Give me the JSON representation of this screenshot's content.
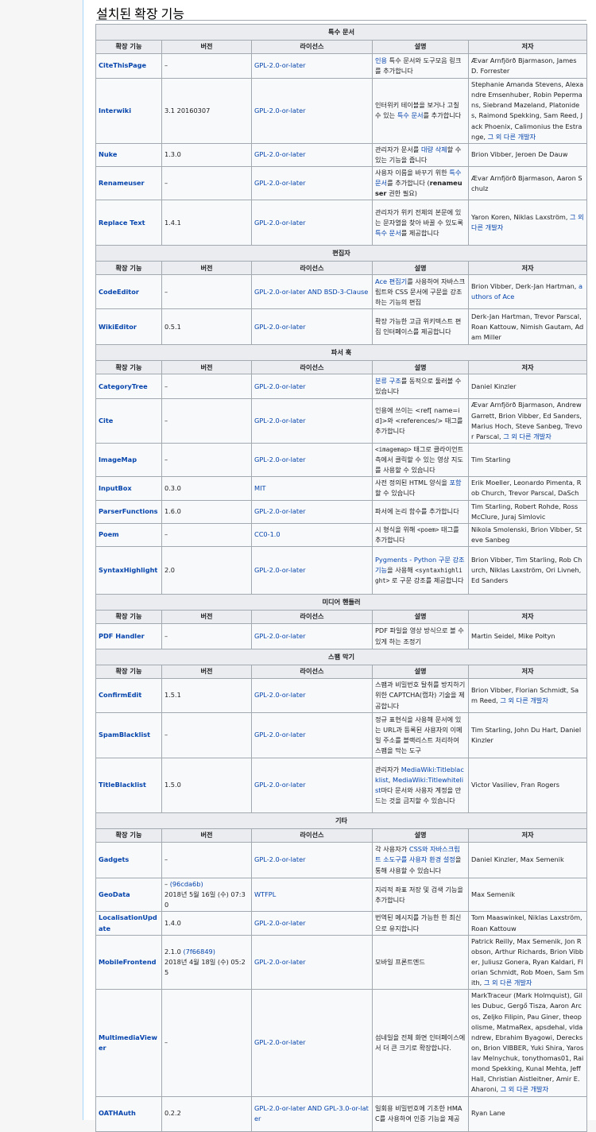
{
  "heading": "설치된 확장 기능",
  "columns": [
    "확장 기능",
    "버전",
    "라이선스",
    "설명",
    "저자"
  ],
  "sections": [
    {
      "title": "특수 문서",
      "rows": [
        {
          "name": "CiteThisPage",
          "version": "–",
          "license": "GPL-2.0-or-later",
          "desc": [
            {
              "t": "인용",
              "l": true
            },
            {
              "t": " 특수 문서와 도구모음 링크를 추가합니다"
            }
          ],
          "authors": [
            {
              "t": "Ævar Arnfjörð Bjarmason, James D. Forrester"
            }
          ]
        },
        {
          "name": "Interwiki",
          "version": "3.1 20160307",
          "license": "GPL-2.0-or-later",
          "desc": [
            {
              "t": "인터위키 테이블을 보거나 고칠 수 있는 "
            },
            {
              "t": "특수 문서",
              "l": true
            },
            {
              "t": "를 추가합니다"
            }
          ],
          "authors": [
            {
              "t": "Stephanie Amanda Stevens, Alexandre Emsenhuber, Robin Pepermans, Siebrand Mazeland, Platonides, Raimond Spekking, Sam Reed, Jack Phoenix, Calimonius the Estrange, "
            },
            {
              "t": "그 외 다른 개발자",
              "l": true
            }
          ]
        },
        {
          "name": "Nuke",
          "version": "1.3.0",
          "license": "GPL-2.0-or-later",
          "desc": [
            {
              "t": "관리자가 문서를 "
            },
            {
              "t": "대량 삭제",
              "l": true
            },
            {
              "t": "할 수 있는 기능을 줍니다"
            }
          ],
          "authors": [
            {
              "t": "Brion Vibber, Jeroen De Dauw"
            }
          ]
        },
        {
          "name": "Renameuser",
          "version": "–",
          "license": "GPL-2.0-or-later",
          "desc": [
            {
              "t": "사용자 이름을 바꾸기 위한 "
            },
            {
              "t": "특수 문서",
              "l": true
            },
            {
              "t": "를 추가합니다 ("
            },
            {
              "t": "renameuser",
              "b": true
            },
            {
              "t": " 권한 필요)"
            }
          ],
          "authors": [
            {
              "t": "Ævar Arnfjörð Bjarmason, Aaron Schulz"
            }
          ]
        },
        {
          "name": "Replace Text",
          "version": "1.4.1",
          "license": "GPL-2.0-or-later",
          "desc": [
            {
              "t": "관리자가 위키 전체의 본문에 있는 문자열을 찾아 바꿀 수 있도록 "
            },
            {
              "t": "특수 문서",
              "l": true
            },
            {
              "t": "를 제공합니다"
            }
          ],
          "authors": [
            {
              "t": "Yaron Koren, Niklas Laxström, "
            },
            {
              "t": "그 외 다른 개발자",
              "l": true
            }
          ]
        }
      ]
    },
    {
      "title": "편집자",
      "rows": [
        {
          "name": "CodeEditor",
          "version": "–",
          "license": "GPL-2.0-or-later AND BSD-3-Clause",
          "desc": [
            {
              "t": "Ace 편집기",
              "l": true
            },
            {
              "t": "를 사용하여 자바스크립트와 CSS 문서에 구문을 강조하는 기능의 편집"
            }
          ],
          "authors": [
            {
              "t": "Brion Vibber, Derk-Jan Hartman, "
            },
            {
              "t": "authors of Ace",
              "l": true
            }
          ]
        },
        {
          "name": "WikiEditor",
          "version": "0.5.1",
          "license": "GPL-2.0-or-later",
          "desc": [
            {
              "t": "확장 가능한 고급 위키텍스트 편집 인터페이스를 제공합니다"
            }
          ],
          "authors": [
            {
              "t": "Derk-Jan Hartman, Trevor Parscal, Roan Kattouw, Nimish Gautam, Adam Miller"
            }
          ]
        }
      ]
    },
    {
      "title": "파서 훅",
      "rows": [
        {
          "name": "CategoryTree",
          "version": "–",
          "license": "GPL-2.0-or-later",
          "desc": [
            {
              "t": "분류 구조",
              "l": true
            },
            {
              "t": "를 동적으로 둘러볼 수 있습니다"
            }
          ],
          "authors": [
            {
              "t": "Daniel Kinzler"
            }
          ]
        },
        {
          "name": "Cite",
          "version": "–",
          "license": "GPL-2.0-or-later",
          "desc": [
            {
              "t": "인용에 쓰이는 <ref[ name=id]>와 <references/> 태그를 추가합니다"
            }
          ],
          "authors": [
            {
              "t": "Ævar Arnfjörð Bjarmason, Andrew Garrett, Brion Vibber, Ed Sanders, Marius Hoch, Steve Sanbeg, Trevor Parscal, "
            },
            {
              "t": "그 외 다른 개발자",
              "l": true
            }
          ]
        },
        {
          "name": "ImageMap",
          "version": "–",
          "license": "GPL-2.0-or-later",
          "desc": [
            {
              "t": "<imagemap>",
              "c": true
            },
            {
              "t": " 태그로 클라이언트 측에서 클릭할 수 있는 영상 지도를 사용할 수 있습니다"
            }
          ],
          "authors": [
            {
              "t": "Tim Starling"
            }
          ]
        },
        {
          "name": "InputBox",
          "version": "0.3.0",
          "license": "MIT",
          "desc": [
            {
              "t": "사전 정의된 HTML 양식을 "
            },
            {
              "t": "포함",
              "l": true
            },
            {
              "t": "할 수 있습니다"
            }
          ],
          "authors": [
            {
              "t": "Erik Moeller, Leonardo Pimenta, Rob Church, Trevor Parscal, DaSch"
            }
          ]
        },
        {
          "name": "ParserFunctions",
          "version": "1.6.0",
          "license": "GPL-2.0-or-later",
          "desc": [
            {
              "t": "파서에 논리 함수를 추가합니다"
            }
          ],
          "authors": [
            {
              "t": "Tim Starling, Robert Rohde, Ross McClure, Juraj Simlovic"
            }
          ]
        },
        {
          "name": "Poem",
          "version": "–",
          "license": "CC0-1.0",
          "desc": [
            {
              "t": "시 형식을 위해 "
            },
            {
              "t": "<poem>",
              "c": true
            },
            {
              "t": " 태그를 추가합니다"
            }
          ],
          "authors": [
            {
              "t": "Nikola Smolenski, Brion Vibber, Steve Sanbeg"
            }
          ]
        },
        {
          "name": "SyntaxHighlight",
          "version": "2.0",
          "license": "GPL-2.0-or-later",
          "desc": [
            {
              "t": "Pygments - Python 구문 강조기능",
              "l": true
            },
            {
              "t": "을 사용해 "
            },
            {
              "t": "<syntaxhighlight>",
              "c": true
            },
            {
              "t": " 로 구문 강조를 제공합니다"
            }
          ],
          "authors": [
            {
              "t": "Brion Vibber, Tim Starling, Rob Church, Niklas Laxström, Ori Livneh, Ed Sanders"
            }
          ]
        }
      ]
    },
    {
      "title": "미디어 핸들러",
      "rows": [
        {
          "name": "PDF Handler",
          "version": "–",
          "license": "GPL-2.0-or-later",
          "desc": [
            {
              "t": "PDF 파일을 영상 방식으로 볼 수 있게 하는 조정기"
            }
          ],
          "authors": [
            {
              "t": "Martin Seidel, Mike Połtyn"
            }
          ]
        }
      ]
    },
    {
      "title": "스팸 막기",
      "rows": [
        {
          "name": "ConfirmEdit",
          "version": "1.5.1",
          "license": "GPL-2.0-or-later",
          "desc": [
            {
              "t": "스팸과 비밀번호 탈취를 방지하기 위한 CAPTCHA(캡차) 기술을 제공합니다"
            }
          ],
          "authors": [
            {
              "t": "Brion Vibber, Florian Schmidt, Sam Reed, "
            },
            {
              "t": "그 외 다른 개발자",
              "l": true
            }
          ]
        },
        {
          "name": "SpamBlacklist",
          "version": "–",
          "license": "GPL-2.0-or-later",
          "desc": [
            {
              "t": "정규 표현식을 사용해 문서에 있는 URL과 등록된 사용자의 이메일 주소를 블랙리스트 처리하여 스팸을 막는 도구"
            }
          ],
          "authors": [
            {
              "t": "Tim Starling, John Du Hart, Daniel Kinzler"
            }
          ]
        },
        {
          "name": "TitleBlacklist",
          "version": "1.5.0",
          "license": "GPL-2.0-or-later",
          "desc": [
            {
              "t": "관리자가 "
            },
            {
              "t": "MediaWiki:Titleblacklist",
              "l": true
            },
            {
              "t": ", "
            },
            {
              "t": "MediaWiki:Titlewhitelist",
              "l": true
            },
            {
              "t": "마다 문서와 사용자 계정을 만드는 것을 금지할 수 있습니다"
            }
          ],
          "authors": [
            {
              "t": "Victor Vasiliev, Fran Rogers"
            }
          ]
        }
      ]
    },
    {
      "title": "기타",
      "rows": [
        {
          "name": "Gadgets",
          "version": "–",
          "license": "GPL-2.0-or-later",
          "desc": [
            {
              "t": "각 사용자가 "
            },
            {
              "t": "CSS와 자바스크립트 소도구를 사용자 환경 설정",
              "l": true
            },
            {
              "t": "을 통해 사용할 수 있습니다"
            }
          ],
          "authors": [
            {
              "t": "Daniel Kinzler, Max Semenik"
            }
          ]
        },
        {
          "name": "GeoData",
          "version_prefix": "– ",
          "version_link": "(96cda6b)",
          "version_date": "2018년 5월 16일 (수) 07:30",
          "license": "WTFPL",
          "desc": [
            {
              "t": "지리적 좌표 저장 및 검색 기능을 추가합니다"
            }
          ],
          "authors": [
            {
              "t": "Max Semenik"
            }
          ]
        },
        {
          "name": "LocalisationUpdate",
          "version": "1.4.0",
          "license": "GPL-2.0-or-later",
          "desc": [
            {
              "t": "번역된 메시지를 가능한 한 최신으로 유지합니다"
            }
          ],
          "authors": [
            {
              "t": "Tom Maaswinkel, Niklas Laxström, Roan Kattouw"
            }
          ]
        },
        {
          "name": "MobileFrontend",
          "version_prefix": "2.1.0 ",
          "version_link": "(7f66849)",
          "version_date": "2018년 4월 18일 (수) 05:25",
          "license": "GPL-2.0-or-later",
          "desc": [
            {
              "t": "모바일 프론트엔드"
            }
          ],
          "authors": [
            {
              "t": "Patrick Reilly, Max Semenik, Jon Robson, Arthur Richards, Brion Vibber, Juliusz Gonera, Ryan Kaldari, Florian Schmidt, Rob Moen, Sam Smith, "
            },
            {
              "t": "그 외 다른 개발자",
              "l": true
            }
          ]
        },
        {
          "name": "MultimediaViewer",
          "version": "–",
          "license": "GPL-2.0-or-later",
          "desc": [
            {
              "t": "섬네일을 전체 화면 인터페이스에서 더 큰 크기로 확장합니다."
            }
          ],
          "authors": [
            {
              "t": "MarkTraceur (Mark Holmquist), Gilles Dubuc, Gergő Tisza, Aaron Arcos, Zeljko Filipin, Pau Giner, theopolisme, MatmaRex, apsdehal, vldandrew, Ebrahim Byagowi, Dereckson, Brion VIBBER, Yuki Shira, Yaroslav Melnychuk, tonythomas01, Raimond Spekking, Kunal Mehta, Jeff Hall, Christian Aistleitner, Amir E. Aharoni, "
            },
            {
              "t": "그 외 다른 개발자",
              "l": true
            }
          ]
        },
        {
          "name": "OATHAuth",
          "version": "0.2.2",
          "license": "GPL-2.0-or-later AND GPL-3.0-or-later",
          "desc": [
            {
              "t": "일회용 비밀번호에 기초한 HMAC를 사용하여 인증 기능을 제공"
            }
          ],
          "authors": [
            {
              "t": "Ryan Lane"
            }
          ]
        }
      ]
    }
  ]
}
